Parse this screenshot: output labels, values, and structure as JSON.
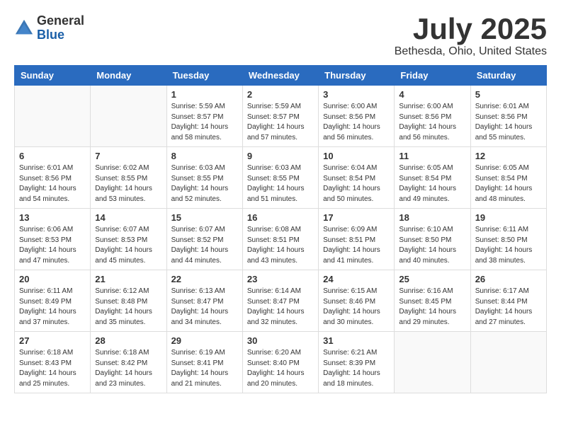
{
  "logo": {
    "general": "General",
    "blue": "Blue"
  },
  "title": "July 2025",
  "location": "Bethesda, Ohio, United States",
  "days_of_week": [
    "Sunday",
    "Monday",
    "Tuesday",
    "Wednesday",
    "Thursday",
    "Friday",
    "Saturday"
  ],
  "weeks": [
    [
      {
        "day": "",
        "sunrise": "",
        "sunset": "",
        "daylight": ""
      },
      {
        "day": "",
        "sunrise": "",
        "sunset": "",
        "daylight": ""
      },
      {
        "day": "1",
        "sunrise": "Sunrise: 5:59 AM",
        "sunset": "Sunset: 8:57 PM",
        "daylight": "Daylight: 14 hours and 58 minutes."
      },
      {
        "day": "2",
        "sunrise": "Sunrise: 5:59 AM",
        "sunset": "Sunset: 8:57 PM",
        "daylight": "Daylight: 14 hours and 57 minutes."
      },
      {
        "day": "3",
        "sunrise": "Sunrise: 6:00 AM",
        "sunset": "Sunset: 8:56 PM",
        "daylight": "Daylight: 14 hours and 56 minutes."
      },
      {
        "day": "4",
        "sunrise": "Sunrise: 6:00 AM",
        "sunset": "Sunset: 8:56 PM",
        "daylight": "Daylight: 14 hours and 56 minutes."
      },
      {
        "day": "5",
        "sunrise": "Sunrise: 6:01 AM",
        "sunset": "Sunset: 8:56 PM",
        "daylight": "Daylight: 14 hours and 55 minutes."
      }
    ],
    [
      {
        "day": "6",
        "sunrise": "Sunrise: 6:01 AM",
        "sunset": "Sunset: 8:56 PM",
        "daylight": "Daylight: 14 hours and 54 minutes."
      },
      {
        "day": "7",
        "sunrise": "Sunrise: 6:02 AM",
        "sunset": "Sunset: 8:55 PM",
        "daylight": "Daylight: 14 hours and 53 minutes."
      },
      {
        "day": "8",
        "sunrise": "Sunrise: 6:03 AM",
        "sunset": "Sunset: 8:55 PM",
        "daylight": "Daylight: 14 hours and 52 minutes."
      },
      {
        "day": "9",
        "sunrise": "Sunrise: 6:03 AM",
        "sunset": "Sunset: 8:55 PM",
        "daylight": "Daylight: 14 hours and 51 minutes."
      },
      {
        "day": "10",
        "sunrise": "Sunrise: 6:04 AM",
        "sunset": "Sunset: 8:54 PM",
        "daylight": "Daylight: 14 hours and 50 minutes."
      },
      {
        "day": "11",
        "sunrise": "Sunrise: 6:05 AM",
        "sunset": "Sunset: 8:54 PM",
        "daylight": "Daylight: 14 hours and 49 minutes."
      },
      {
        "day": "12",
        "sunrise": "Sunrise: 6:05 AM",
        "sunset": "Sunset: 8:54 PM",
        "daylight": "Daylight: 14 hours and 48 minutes."
      }
    ],
    [
      {
        "day": "13",
        "sunrise": "Sunrise: 6:06 AM",
        "sunset": "Sunset: 8:53 PM",
        "daylight": "Daylight: 14 hours and 47 minutes."
      },
      {
        "day": "14",
        "sunrise": "Sunrise: 6:07 AM",
        "sunset": "Sunset: 8:53 PM",
        "daylight": "Daylight: 14 hours and 45 minutes."
      },
      {
        "day": "15",
        "sunrise": "Sunrise: 6:07 AM",
        "sunset": "Sunset: 8:52 PM",
        "daylight": "Daylight: 14 hours and 44 minutes."
      },
      {
        "day": "16",
        "sunrise": "Sunrise: 6:08 AM",
        "sunset": "Sunset: 8:51 PM",
        "daylight": "Daylight: 14 hours and 43 minutes."
      },
      {
        "day": "17",
        "sunrise": "Sunrise: 6:09 AM",
        "sunset": "Sunset: 8:51 PM",
        "daylight": "Daylight: 14 hours and 41 minutes."
      },
      {
        "day": "18",
        "sunrise": "Sunrise: 6:10 AM",
        "sunset": "Sunset: 8:50 PM",
        "daylight": "Daylight: 14 hours and 40 minutes."
      },
      {
        "day": "19",
        "sunrise": "Sunrise: 6:11 AM",
        "sunset": "Sunset: 8:50 PM",
        "daylight": "Daylight: 14 hours and 38 minutes."
      }
    ],
    [
      {
        "day": "20",
        "sunrise": "Sunrise: 6:11 AM",
        "sunset": "Sunset: 8:49 PM",
        "daylight": "Daylight: 14 hours and 37 minutes."
      },
      {
        "day": "21",
        "sunrise": "Sunrise: 6:12 AM",
        "sunset": "Sunset: 8:48 PM",
        "daylight": "Daylight: 14 hours and 35 minutes."
      },
      {
        "day": "22",
        "sunrise": "Sunrise: 6:13 AM",
        "sunset": "Sunset: 8:47 PM",
        "daylight": "Daylight: 14 hours and 34 minutes."
      },
      {
        "day": "23",
        "sunrise": "Sunrise: 6:14 AM",
        "sunset": "Sunset: 8:47 PM",
        "daylight": "Daylight: 14 hours and 32 minutes."
      },
      {
        "day": "24",
        "sunrise": "Sunrise: 6:15 AM",
        "sunset": "Sunset: 8:46 PM",
        "daylight": "Daylight: 14 hours and 30 minutes."
      },
      {
        "day": "25",
        "sunrise": "Sunrise: 6:16 AM",
        "sunset": "Sunset: 8:45 PM",
        "daylight": "Daylight: 14 hours and 29 minutes."
      },
      {
        "day": "26",
        "sunrise": "Sunrise: 6:17 AM",
        "sunset": "Sunset: 8:44 PM",
        "daylight": "Daylight: 14 hours and 27 minutes."
      }
    ],
    [
      {
        "day": "27",
        "sunrise": "Sunrise: 6:18 AM",
        "sunset": "Sunset: 8:43 PM",
        "daylight": "Daylight: 14 hours and 25 minutes."
      },
      {
        "day": "28",
        "sunrise": "Sunrise: 6:18 AM",
        "sunset": "Sunset: 8:42 PM",
        "daylight": "Daylight: 14 hours and 23 minutes."
      },
      {
        "day": "29",
        "sunrise": "Sunrise: 6:19 AM",
        "sunset": "Sunset: 8:41 PM",
        "daylight": "Daylight: 14 hours and 21 minutes."
      },
      {
        "day": "30",
        "sunrise": "Sunrise: 6:20 AM",
        "sunset": "Sunset: 8:40 PM",
        "daylight": "Daylight: 14 hours and 20 minutes."
      },
      {
        "day": "31",
        "sunrise": "Sunrise: 6:21 AM",
        "sunset": "Sunset: 8:39 PM",
        "daylight": "Daylight: 14 hours and 18 minutes."
      },
      {
        "day": "",
        "sunrise": "",
        "sunset": "",
        "daylight": ""
      },
      {
        "day": "",
        "sunrise": "",
        "sunset": "",
        "daylight": ""
      }
    ]
  ]
}
